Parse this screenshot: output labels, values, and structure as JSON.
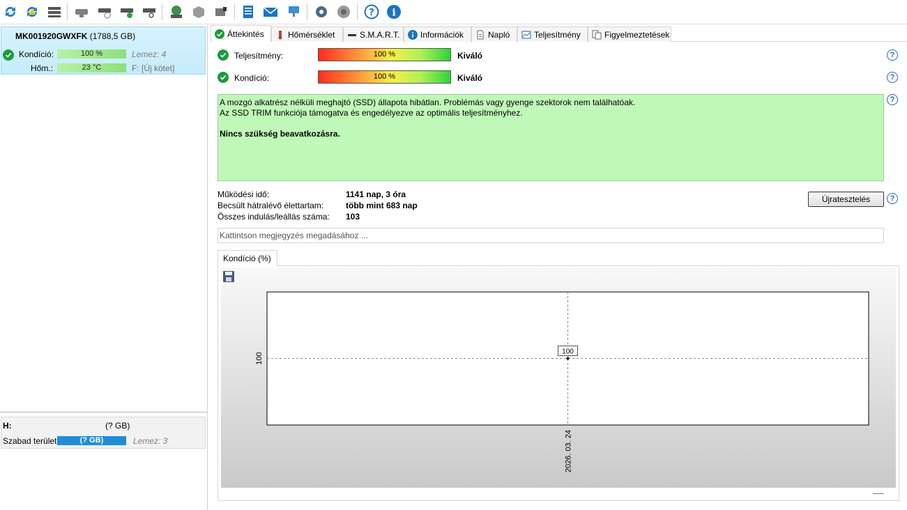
{
  "toolbar": {
    "icons": [
      "refresh-icon",
      "refresh-warning-icon",
      "disk-list-icon",
      "disk-gray-icon",
      "disk-clock-icon",
      "disk-check-icon",
      "disk-search-icon",
      "globe-icon",
      "server-icon",
      "drive-icon",
      "notepad-icon",
      "mail-icon",
      "network-icon",
      "settings-icon",
      "speaker-icon",
      "help-icon",
      "info-icon"
    ]
  },
  "sidebar": {
    "disk": {
      "name": "MK001920GWXFK",
      "size": "(1788,5 GB)",
      "condition_label": "Kondíció:",
      "condition_value": "100 %",
      "condition_percent": 100,
      "disk_index": "Lemez: 4",
      "temp_label": "Hőm.:",
      "temp_value": "23 °C",
      "volume_info": "F: [Új kötet]"
    },
    "volume": {
      "letter": "H:",
      "size": "(? GB)",
      "free_label": "Szabad terület",
      "free_value": "(? GB)",
      "disk_index": "Lemez: 3"
    }
  },
  "tabs": [
    {
      "label": "Áttekintés",
      "icon": "check-icon",
      "active": true
    },
    {
      "label": "Hőmérséklet",
      "icon": "thermometer-icon"
    },
    {
      "label": "S.M.A.R.T.",
      "icon": "dash-icon"
    },
    {
      "label": "Információk",
      "icon": "info-icon"
    },
    {
      "label": "Napló",
      "icon": "document-icon"
    },
    {
      "label": "Teljesítmény",
      "icon": "chart-icon"
    },
    {
      "label": "Figyelmeztetések",
      "icon": "warnings-icon"
    }
  ],
  "overview": {
    "performance_label": "Teljesítmény:",
    "performance_value": "100 %",
    "performance_percent": 100,
    "performance_rating": "Kiváló",
    "condition_label": "Kondíció:",
    "condition_value": "100 %",
    "condition_percent": 100,
    "condition_rating": "Kiváló",
    "message_line1": "A mozgó alkatrész nélküli meghajtó (SSD) állapota hibátlan. Problémás vagy gyenge szektorok nem találhatóak.",
    "message_line2": "Az SSD TRIM funkciója támogatva és engedélyezve az optimális teljesítményhez.",
    "message_bold": "Nincs szükség beavatkozásra.",
    "uptime_label": "Működési idő:",
    "uptime_value": "1141 nap, 3 óra",
    "lifetime_label": "Becsült hátralévő élettartam:",
    "lifetime_value": "több mint 683 nap",
    "startstop_label": "Összes indulás/leállás száma:",
    "startstop_value": "103",
    "retest_button": "Újratesztelés",
    "note_placeholder": "Kattintson megjegyzés megadásához ..."
  },
  "chart_tab": "Kondíció  (%)",
  "chart_data": {
    "type": "line",
    "x": [
      "2026. 03. 24"
    ],
    "series": [
      {
        "values": [
          100
        ]
      }
    ],
    "point_label": "100",
    "ylabel_tick": "100",
    "grid": true
  }
}
